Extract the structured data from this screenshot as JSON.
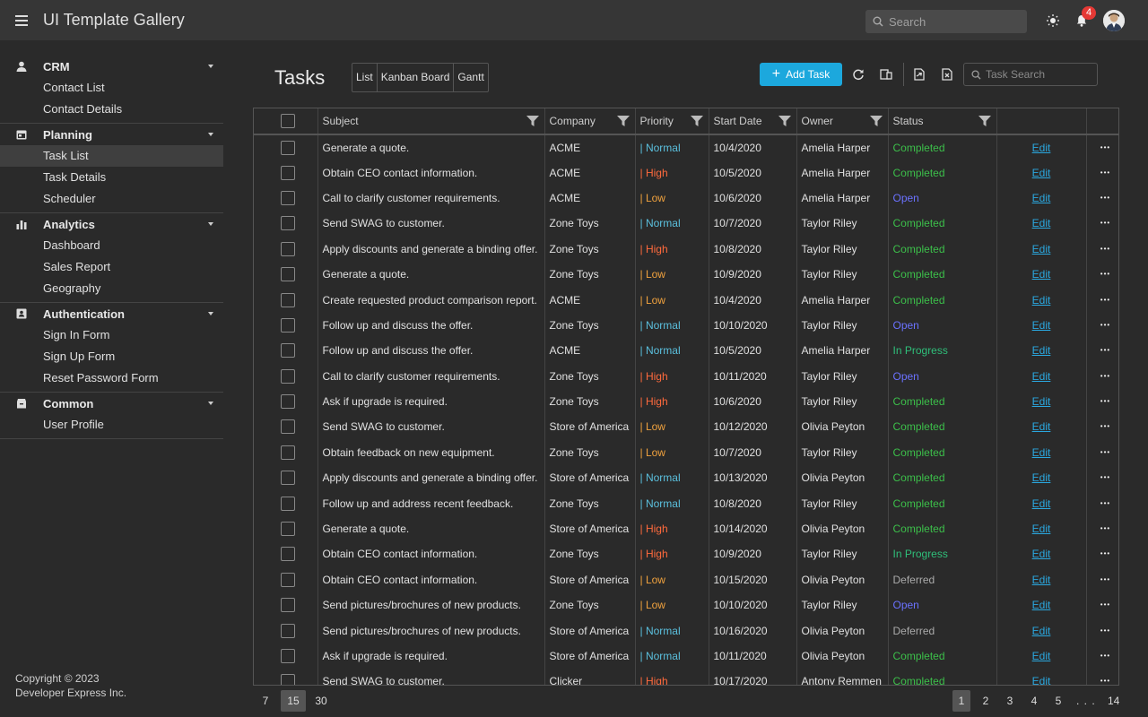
{
  "header": {
    "title": "UI Template Gallery",
    "search_placeholder": "Search",
    "notification_count": "4"
  },
  "sidebar": {
    "groups": [
      {
        "label": "CRM",
        "icon": "person-icon",
        "items": [
          {
            "label": "Contact List"
          },
          {
            "label": "Contact Details"
          }
        ]
      },
      {
        "label": "Planning",
        "icon": "calendar-icon",
        "items": [
          {
            "label": "Task List",
            "active": true
          },
          {
            "label": "Task Details"
          },
          {
            "label": "Scheduler"
          }
        ]
      },
      {
        "label": "Analytics",
        "icon": "chart-icon",
        "items": [
          {
            "label": "Dashboard"
          },
          {
            "label": "Sales Report"
          },
          {
            "label": "Geography"
          }
        ]
      },
      {
        "label": "Authentication",
        "icon": "id-card-icon",
        "items": [
          {
            "label": "Sign In Form"
          },
          {
            "label": "Sign Up Form"
          },
          {
            "label": "Reset Password Form"
          }
        ]
      },
      {
        "label": "Common",
        "icon": "box-icon",
        "items": [
          {
            "label": "User Profile"
          }
        ]
      }
    ],
    "copyright_line1": "Copyright © 2023",
    "copyright_line2": "Developer Express Inc."
  },
  "main": {
    "title": "Tasks",
    "views": [
      "List",
      "Kanban Board",
      "Gantt"
    ],
    "add_task_label": "Add Task",
    "task_search_placeholder": "Task Search"
  },
  "grid": {
    "columns": [
      "Subject",
      "Company",
      "Priority",
      "Start Date",
      "Owner",
      "Status"
    ],
    "edit_label": "Edit",
    "rows": [
      {
        "subject": "Generate a quote.",
        "company": "ACME",
        "priority": "Normal",
        "start": "10/4/2020",
        "owner": "Amelia Harper",
        "status": "Completed"
      },
      {
        "subject": "Obtain CEO contact information.",
        "company": "ACME",
        "priority": "High",
        "start": "10/5/2020",
        "owner": "Amelia Harper",
        "status": "Completed"
      },
      {
        "subject": "Call to clarify customer requirements.",
        "company": "ACME",
        "priority": "Low",
        "start": "10/6/2020",
        "owner": "Amelia Harper",
        "status": "Open"
      },
      {
        "subject": "Send SWAG to customer.",
        "company": "Zone Toys",
        "priority": "Normal",
        "start": "10/7/2020",
        "owner": "Taylor Riley",
        "status": "Completed"
      },
      {
        "subject": "Apply discounts and generate a binding offer.",
        "company": "Zone Toys",
        "priority": "High",
        "start": "10/8/2020",
        "owner": "Taylor Riley",
        "status": "Completed"
      },
      {
        "subject": "Generate a quote.",
        "company": "Zone Toys",
        "priority": "Low",
        "start": "10/9/2020",
        "owner": "Taylor Riley",
        "status": "Completed"
      },
      {
        "subject": "Create requested product comparison report.",
        "company": "ACME",
        "priority": "Low",
        "start": "10/4/2020",
        "owner": "Amelia Harper",
        "status": "Completed"
      },
      {
        "subject": "Follow up and discuss the offer.",
        "company": "Zone Toys",
        "priority": "Normal",
        "start": "10/10/2020",
        "owner": "Taylor Riley",
        "status": "Open"
      },
      {
        "subject": "Follow up and discuss the offer.",
        "company": "ACME",
        "priority": "Normal",
        "start": "10/5/2020",
        "owner": "Amelia Harper",
        "status": "In Progress"
      },
      {
        "subject": "Call to clarify customer requirements.",
        "company": "Zone Toys",
        "priority": "High",
        "start": "10/11/2020",
        "owner": "Taylor Riley",
        "status": "Open"
      },
      {
        "subject": "Ask if upgrade is required.",
        "company": "Zone Toys",
        "priority": "High",
        "start": "10/6/2020",
        "owner": "Taylor Riley",
        "status": "Completed"
      },
      {
        "subject": "Send SWAG to customer.",
        "company": "Store of America",
        "priority": "Low",
        "start": "10/12/2020",
        "owner": "Olivia Peyton",
        "status": "Completed"
      },
      {
        "subject": "Obtain feedback on new equipment.",
        "company": "Zone Toys",
        "priority": "Low",
        "start": "10/7/2020",
        "owner": "Taylor Riley",
        "status": "Completed"
      },
      {
        "subject": "Apply discounts and generate a binding offer.",
        "company": "Store of America",
        "priority": "Normal",
        "start": "10/13/2020",
        "owner": "Olivia Peyton",
        "status": "Completed"
      },
      {
        "subject": "Follow up and address recent feedback.",
        "company": "Zone Toys",
        "priority": "Normal",
        "start": "10/8/2020",
        "owner": "Taylor Riley",
        "status": "Completed"
      },
      {
        "subject": "Generate a quote.",
        "company": "Store of America",
        "priority": "High",
        "start": "10/14/2020",
        "owner": "Olivia Peyton",
        "status": "Completed"
      },
      {
        "subject": "Obtain CEO contact information.",
        "company": "Zone Toys",
        "priority": "High",
        "start": "10/9/2020",
        "owner": "Taylor Riley",
        "status": "In Progress"
      },
      {
        "subject": "Obtain CEO contact information.",
        "company": "Store of America",
        "priority": "Low",
        "start": "10/15/2020",
        "owner": "Olivia Peyton",
        "status": "Deferred"
      },
      {
        "subject": "Send pictures/brochures of new products.",
        "company": "Zone Toys",
        "priority": "Low",
        "start": "10/10/2020",
        "owner": "Taylor Riley",
        "status": "Open"
      },
      {
        "subject": "Send pictures/brochures of new products.",
        "company": "Store of America",
        "priority": "Normal",
        "start": "10/16/2020",
        "owner": "Olivia Peyton",
        "status": "Deferred"
      },
      {
        "subject": "Ask if upgrade is required.",
        "company": "Store of America",
        "priority": "Normal",
        "start": "10/11/2020",
        "owner": "Olivia Peyton",
        "status": "Completed"
      },
      {
        "subject": "Send SWAG to customer.",
        "company": "Clicker",
        "priority": "High",
        "start": "10/17/2020",
        "owner": "Antony Remmen",
        "status": "Completed"
      }
    ]
  },
  "pager": {
    "sizes": [
      "7",
      "15",
      "30"
    ],
    "active_size": "15",
    "pages": [
      "1",
      "2",
      "3",
      "4",
      "5",
      ". . .",
      "14"
    ],
    "active_page": "1"
  },
  "colors": {
    "accent": "#1ca8dd",
    "priority_normal": "#5bc0de",
    "priority_high": "#ff6a3d",
    "priority_low": "#f0a23e",
    "status_completed": "#3cbf4a",
    "status_open": "#6b72ff",
    "status_in_progress": "#2fbf7a",
    "status_deferred": "#aaaaaa"
  }
}
